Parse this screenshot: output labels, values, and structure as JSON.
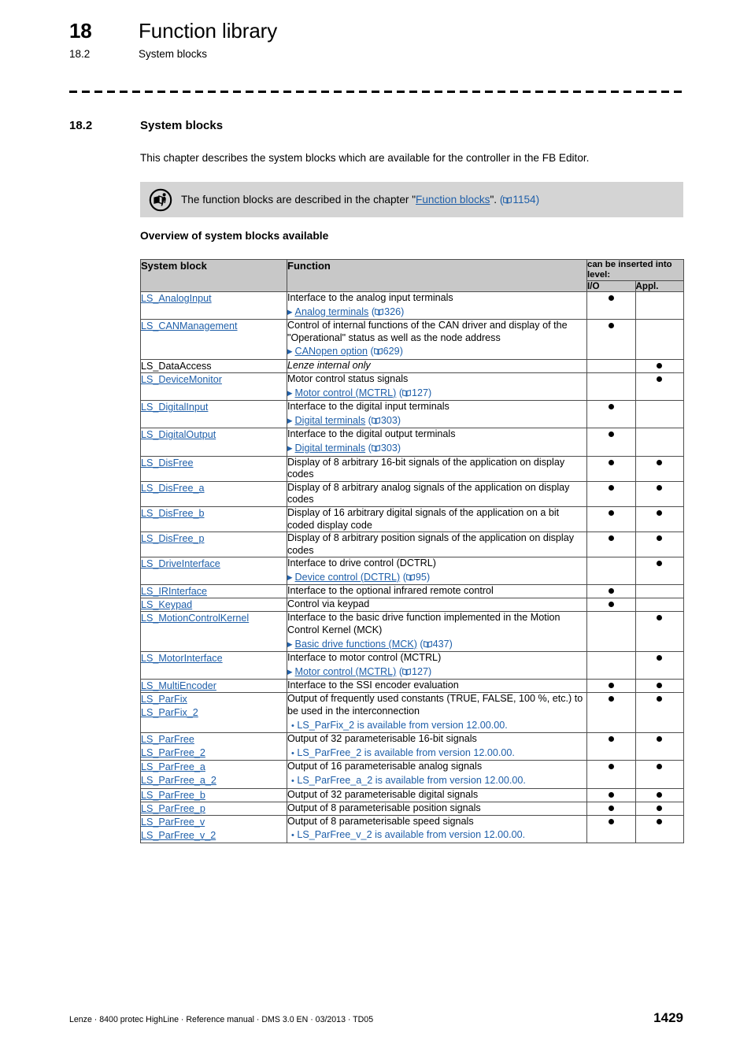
{
  "running_header": {
    "chapter_number": "18",
    "chapter_title": "Function library",
    "section_number": "18.2",
    "section_title": "System blocks"
  },
  "section": {
    "number": "18.2",
    "title": "System blocks",
    "intro": "This chapter describes the system blocks which are available for the controller in the FB Editor."
  },
  "note": {
    "icon": "read-documentation-icon",
    "text_before": "The function blocks are described in the chapter \"",
    "link": "Function blocks",
    "text_after": "\".",
    "page": "1154"
  },
  "overview_heading": "Overview of system blocks available",
  "table": {
    "headers": {
      "system_block": "System block",
      "function": "Function",
      "level_group": "can be inserted into level:",
      "io": "I/O",
      "appl": "Appl."
    },
    "rows": [
      {
        "names": [
          "LS_AnalogInput"
        ],
        "linked": true,
        "desc": "Interface to the analog input terminals",
        "xref": {
          "label": "Analog terminals",
          "page": "326"
        },
        "io": true,
        "appl": false
      },
      {
        "names": [
          "LS_CANManagement"
        ],
        "linked": true,
        "desc": "Control of internal functions of the CAN driver and display of the \"Operational\" status as well as the node address",
        "xref": {
          "label": "CANopen option",
          "page": "629"
        },
        "io": true,
        "appl": false
      },
      {
        "names": [
          "LS_DataAccess"
        ],
        "linked": false,
        "desc": "Lenze internal only",
        "desc_italic": true,
        "io": false,
        "appl": true
      },
      {
        "names": [
          "LS_DeviceMonitor"
        ],
        "linked": true,
        "desc": "Motor control status signals",
        "xref": {
          "label": "Motor control (MCTRL)",
          "page": "127"
        },
        "io": false,
        "appl": true
      },
      {
        "names": [
          "LS_DigitalInput"
        ],
        "linked": true,
        "desc": "Interface to the digital input terminals",
        "xref": {
          "label": "Digital terminals",
          "page": "303"
        },
        "io": true,
        "appl": false
      },
      {
        "names": [
          "LS_DigitalOutput"
        ],
        "linked": true,
        "desc": "Interface to the digital output terminals",
        "xref": {
          "label": "Digital terminals",
          "page": "303"
        },
        "io": true,
        "appl": false
      },
      {
        "names": [
          "LS_DisFree"
        ],
        "linked": true,
        "desc": "Display of 8 arbitrary 16-bit signals of the application on display codes",
        "io": true,
        "appl": true
      },
      {
        "names": [
          "LS_DisFree_a"
        ],
        "linked": true,
        "desc": "Display of 8 arbitrary analog signals of the application on display codes",
        "io": true,
        "appl": true
      },
      {
        "names": [
          "LS_DisFree_b"
        ],
        "linked": true,
        "desc": "Display of 16 arbitrary digital signals of the application on a bit coded display code",
        "io": true,
        "appl": true
      },
      {
        "names": [
          "LS_DisFree_p"
        ],
        "linked": true,
        "desc": "Display of 8 arbitrary position signals of the application on display codes",
        "io": true,
        "appl": true
      },
      {
        "names": [
          "LS_DriveInterface"
        ],
        "linked": true,
        "desc": "Interface to drive control (DCTRL)",
        "xref": {
          "label": "Device control (DCTRL)",
          "page": "95"
        },
        "io": false,
        "appl": true
      },
      {
        "names": [
          "LS_IRInterface"
        ],
        "linked": true,
        "desc": "Interface to the optional infrared remote control",
        "io": true,
        "appl": false
      },
      {
        "names": [
          "LS_Keypad"
        ],
        "linked": true,
        "desc": "Control via keypad",
        "io": true,
        "appl": false
      },
      {
        "names": [
          "LS_MotionControlKernel"
        ],
        "linked": true,
        "desc": "Interface to the basic drive function implemented in the Motion Control Kernel (MCK)",
        "xref": {
          "label": "Basic drive functions (MCK)",
          "page": "437"
        },
        "io": false,
        "appl": true
      },
      {
        "names": [
          "LS_MotorInterface"
        ],
        "linked": true,
        "desc": "Interface to motor control (MCTRL)",
        "xref": {
          "label": "Motor control (MCTRL)",
          "page": "127"
        },
        "io": false,
        "appl": true
      },
      {
        "names": [
          "LS_MultiEncoder"
        ],
        "linked": true,
        "desc": "Interface to the SSI encoder evaluation",
        "io": true,
        "appl": true
      },
      {
        "names": [
          "LS_ParFix",
          "LS_ParFix_2"
        ],
        "linked": true,
        "desc": "Output of frequently used constants (TRUE, FALSE, 100 %, etc.) to be used in the interconnection",
        "note_bullet": "LS_ParFix_2 is available from version 12.00.00.",
        "io": true,
        "appl": true
      },
      {
        "names": [
          "LS_ParFree",
          "LS_ParFree_2"
        ],
        "linked": true,
        "desc": "Output of 32 parameterisable 16-bit signals",
        "note_bullet": "LS_ParFree_2 is available from version 12.00.00.",
        "io": true,
        "appl": true
      },
      {
        "names": [
          "LS_ParFree_a",
          "LS_ParFree_a_2"
        ],
        "linked": true,
        "desc": "Output of 16 parameterisable analog signals",
        "note_bullet": "LS_ParFree_a_2 is available from version 12.00.00.",
        "io": true,
        "appl": true
      },
      {
        "names": [
          "LS_ParFree_b"
        ],
        "linked": true,
        "desc": "Output of 32 parameterisable digital signals",
        "io": true,
        "appl": true
      },
      {
        "names": [
          "LS_ParFree_p"
        ],
        "linked": true,
        "desc": "Output of 8 parameterisable position signals",
        "io": true,
        "appl": true
      },
      {
        "names": [
          "LS_ParFree_v",
          "LS_ParFree_v_2"
        ],
        "linked": true,
        "desc": "Output of 8 parameterisable speed signals",
        "note_bullet": "LS_ParFree_v_2 is available from version 12.00.00.",
        "io": true,
        "appl": true
      }
    ]
  },
  "footer": {
    "left": "Lenze · 8400 protec HighLine · Reference manual · DMS 3.0 EN · 03/2013 · TD05",
    "page_number": "1429"
  },
  "colors": {
    "link": "#1f5fa9",
    "note_background": "#d4d4d4",
    "table_header_background": "#c8c8c8",
    "table_border": "#4d4d4d"
  }
}
